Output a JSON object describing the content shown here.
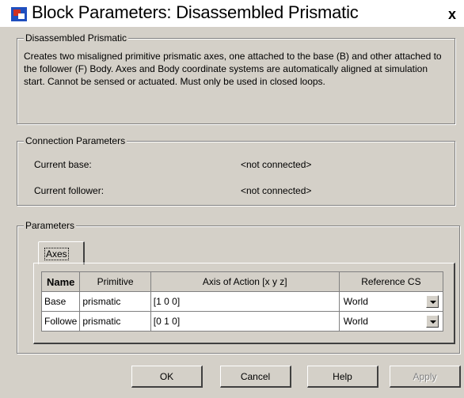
{
  "window": {
    "title": "Block Parameters: Disassembled Prismatic",
    "close_label": "x"
  },
  "description_group": {
    "legend": "Disassembled Prismatic",
    "text": "Creates two misaligned primitive prismatic axes, one attached to the base (B) and other attached to the follower (F) Body. Axes and Body coordinate systems are automatically aligned at simulation start. Cannot be sensed or actuated. Must only be used in closed loops."
  },
  "connection_group": {
    "legend": "Connection Parameters",
    "rows": [
      {
        "label": "Current base:",
        "value": "<not connected>"
      },
      {
        "label": "Current follower:",
        "value": "<not connected>"
      }
    ]
  },
  "parameters_group": {
    "legend": "Parameters",
    "tabs": [
      {
        "label": "Axes"
      }
    ],
    "table": {
      "headers": [
        "Name",
        "Primitive",
        "Axis of Action [x y z]",
        "Reference CS"
      ],
      "rows": [
        {
          "name": "Base",
          "primitive": "prismatic",
          "axis": "[1 0 0]",
          "reference": "World"
        },
        {
          "name": "Followe",
          "primitive": "prismatic",
          "axis": "[0 1 0]",
          "reference": "World"
        }
      ]
    }
  },
  "buttons": {
    "ok": "OK",
    "cancel": "Cancel",
    "help": "Help",
    "apply": "Apply"
  },
  "colors": {
    "dialog_bg": "#d4d0c8",
    "title_bg": "#ffffff",
    "icon_blue": "#1f4fbf",
    "icon_red": "#d03020"
  }
}
